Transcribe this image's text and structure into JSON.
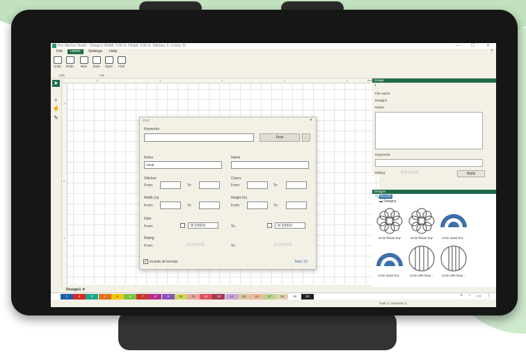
{
  "window": {
    "title": "Pro-Stitcher Studio - Design1 (Width: 0.00 in, Height: 0.00 in, Stitches: 0, Colors: 0)",
    "help": "?",
    "minimize": "—",
    "maximize": "☐",
    "close": "✕"
  },
  "menu": [
    "File",
    "Home",
    "Settings",
    "Help"
  ],
  "ribbon": {
    "buttons": [
      "Undo",
      "Redo",
      "New",
      "Save",
      "Open",
      "Find"
    ],
    "groups": [
      "Edit",
      "File"
    ]
  },
  "ruler": {
    "units": "inches",
    "top": [
      "-2",
      "-1",
      "0",
      "1",
      "2"
    ],
    "left": [
      "0",
      "-1",
      "0",
      "1"
    ]
  },
  "design_panel": {
    "title": "Design",
    "file_name_label": "File name:",
    "file_name": "Design1",
    "notes_label": "Notes:",
    "keywords_label": "Keywords:",
    "rating_label": "Rating:",
    "rating_stars": "☆☆☆☆☆",
    "apply": "Apply"
  },
  "designs_panel": {
    "title": "Designs",
    "tree": [
      "Results",
      "Designs"
    ],
    "thumbs": [
      "circle flower.hqv",
      "circle flower.hqv",
      "circle stack bor...",
      "circle stack bor...",
      "circle with lines...",
      "circle with lines..."
    ]
  },
  "find_dialog": {
    "title": "Find",
    "close": "✕",
    "keywords_label": "Keywords",
    "find_button": "Find",
    "more_button": "...",
    "notes_label": "Notes",
    "notes_value": "circle",
    "name_label": "Name",
    "stitches_label": "Stitches",
    "colors_label": "Colors",
    "width_label": "Width (in)",
    "height_label": "Height (in)",
    "from_label": "From:",
    "to_label": "To:",
    "date_label": "Date",
    "date_from": "9/ 2/2019",
    "date_to": "9/ 2/2019",
    "rating_label": "Rating:",
    "stars": "☆☆☆☆☆",
    "include_all_formats": "Include all formats",
    "total": "Total: 23"
  },
  "doc_tab": {
    "label": "Design1",
    "close": "✕"
  },
  "palette": [
    "1",
    "2",
    "3",
    "4",
    "5",
    "6",
    "7",
    "8",
    "9",
    "10",
    "11",
    "12",
    "13",
    "14",
    "15",
    "16",
    "17",
    "18",
    "19",
    "20"
  ],
  "palette_colors": [
    "#1c5fa8",
    "#d62828",
    "#1aa78a",
    "#e3701a",
    "#f1c30b",
    "#7cc242",
    "#c6342a",
    "#b52d8f",
    "#8a52b8",
    "#d1d55a",
    "#e8a6a0",
    "#e0505a",
    "#a33a52",
    "#c6a5d6",
    "#d8c3a0",
    "#f0b89a",
    "#bcd48c",
    "#e0d2b0",
    "#ffffff",
    "#222222"
  ],
  "status": "Total: 0, Selected: 0"
}
